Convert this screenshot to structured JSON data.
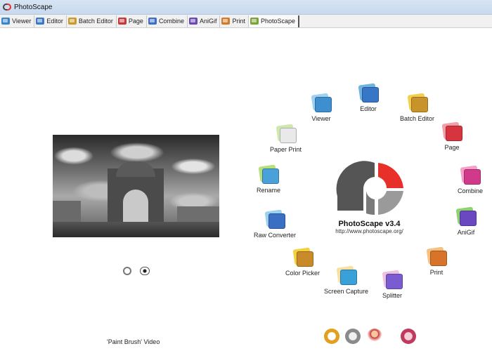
{
  "window": {
    "title": "PhotoScape"
  },
  "tabs": [
    {
      "label": "Viewer",
      "icon": "viewer-icon",
      "color": "#3b86c8"
    },
    {
      "label": "Editor",
      "icon": "editor-icon",
      "color": "#3a79c7"
    },
    {
      "label": "Batch Editor",
      "icon": "batch-editor-icon",
      "color": "#c99a2b"
    },
    {
      "label": "Page",
      "icon": "page-icon",
      "color": "#c43a3a"
    },
    {
      "label": "Combine",
      "icon": "combine-icon",
      "color": "#3d6fc9"
    },
    {
      "label": "AniGif",
      "icon": "anigif-icon",
      "color": "#6b48b3"
    },
    {
      "label": "Print",
      "icon": "print-icon",
      "color": "#d07a2a"
    },
    {
      "label": "PhotoScape",
      "icon": "photoscape-icon",
      "color": "#7aa33a",
      "active": true
    }
  ],
  "brand": {
    "name": "PhotoScape v3.4",
    "url": "http://www.photoscape.org/"
  },
  "launcher": [
    {
      "label": "Editor",
      "icon": "editor-icon",
      "c1": "#6fb3e0",
      "c2": "#3876c8"
    },
    {
      "label": "Batch Editor",
      "icon": "batch-editor-icon",
      "c1": "#f2cf50",
      "c2": "#c9932b"
    },
    {
      "label": "Viewer",
      "icon": "viewer-icon",
      "c1": "#9fd2f0",
      "c2": "#3e8fd0"
    },
    {
      "label": "Page",
      "icon": "page-icon",
      "c1": "#f0a0a8",
      "c2": "#d6343e"
    },
    {
      "label": "Paper Print",
      "icon": "paper-print-icon",
      "c1": "#cfe8b0",
      "c2": "#e9e9e9"
    },
    {
      "label": "Combine",
      "icon": "combine-icon",
      "c1": "#f5a0c8",
      "c2": "#d13a8a"
    },
    {
      "label": "Rename",
      "icon": "rename-icon",
      "c1": "#b8e07a",
      "c2": "#4aa0d8"
    },
    {
      "label": "AniGif",
      "icon": "anigif-icon",
      "c1": "#8fd070",
      "c2": "#6a48c0"
    },
    {
      "label": "Raw Converter",
      "icon": "raw-converter-icon",
      "c1": "#9ad0f0",
      "c2": "#3a6fc4"
    },
    {
      "label": "Print",
      "icon": "print-icon",
      "c1": "#f6c080",
      "c2": "#d8742a"
    },
    {
      "label": "Color Picker",
      "icon": "color-picker-icon",
      "c1": "#f4d040",
      "c2": "#c98a2a"
    },
    {
      "label": "Splitter",
      "icon": "splitter-icon",
      "c1": "#f0c0e0",
      "c2": "#7a5cd0"
    },
    {
      "label": "Screen Capture",
      "icon": "screen-capture-icon",
      "c1": "#f7e0a0",
      "c2": "#3aa0d8"
    }
  ],
  "bottom": {
    "video_label": "'Paint Brush' Video"
  },
  "bottom_icons": [
    "help-icon",
    "tools-icon",
    "people-icon",
    "faq-icon"
  ],
  "photo_controls": [
    "rotate-icon",
    "eye-icon"
  ],
  "colors": {
    "logo_red": "#e8302a",
    "logo_dark": "#555555",
    "logo_gray": "#9a9a9a",
    "title_bar": "#cddcef"
  }
}
